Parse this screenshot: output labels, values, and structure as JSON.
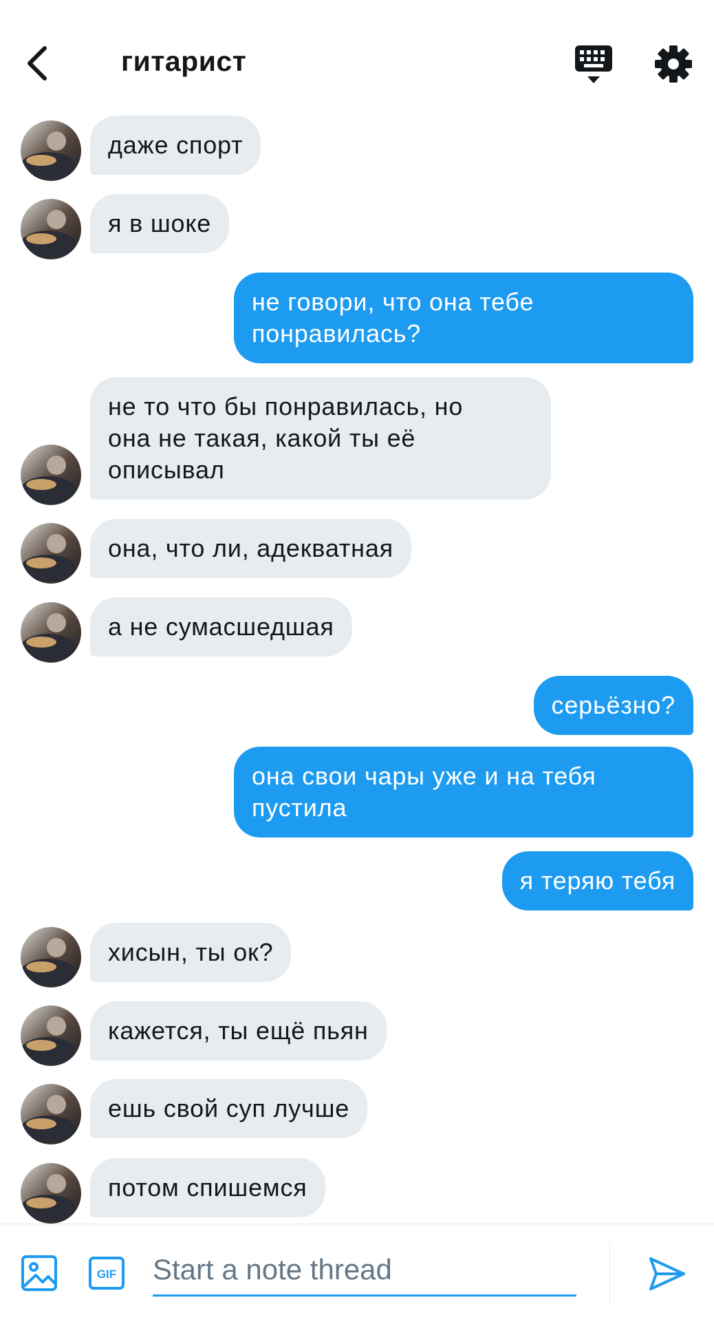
{
  "header": {
    "title": "гитарист",
    "back_icon": "chevron-left-icon",
    "keyboard_icon": "keyboard-icon",
    "settings_icon": "gear-icon"
  },
  "messages": [
    {
      "side": "in",
      "text": "даже спорт"
    },
    {
      "side": "in",
      "text": "я в шоке"
    },
    {
      "side": "out",
      "text": "не говори, что она тебе\nпонравилась?"
    },
    {
      "side": "in",
      "text": "не то что бы понравилась, но\nона не такая, какой ты её\nописывал"
    },
    {
      "side": "in",
      "text": "она, что ли, адекватная"
    },
    {
      "side": "in",
      "text": "а не сумасшедшая"
    },
    {
      "side": "out",
      "text": "серьёзно?"
    },
    {
      "side": "out",
      "text": "она свои чары уже и на тебя\nпустила"
    },
    {
      "side": "out",
      "text": "я теряю тебя"
    },
    {
      "side": "in",
      "text": "хисын, ты ок?"
    },
    {
      "side": "in",
      "text": "кажется, ты ещё пьян"
    },
    {
      "side": "in",
      "text": "ешь свой суп лучше"
    },
    {
      "side": "in",
      "text": "потом спишемся"
    }
  ],
  "composer": {
    "placeholder": "Start a note thread",
    "image_icon": "image-icon",
    "gif_icon": "gif-icon",
    "gif_label": "GIF",
    "send_icon": "send-icon"
  },
  "colors": {
    "accent": "#1d9bf0",
    "incoming_bubble": "#e6ecf0",
    "text": "#14171a",
    "placeholder": "#657786"
  }
}
